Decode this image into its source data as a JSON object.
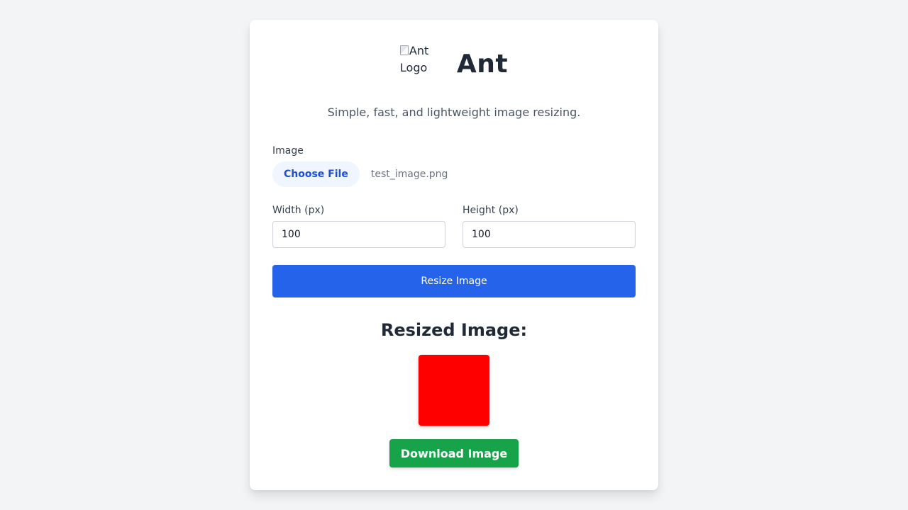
{
  "header": {
    "logo_alt": "Ant Logo",
    "title": "Ant"
  },
  "tagline": "Simple, fast, and lightweight image resizing.",
  "form": {
    "image_label": "Image",
    "choose_file_label": "Choose File",
    "selected_file": "test_image.png",
    "width_label": "Width (px)",
    "width_value": "100",
    "height_label": "Height (px)",
    "height_value": "100",
    "resize_label": "Resize Image"
  },
  "result": {
    "title": "Resized Image:",
    "image_color": "#ff0000",
    "download_label": "Download Image"
  },
  "colors": {
    "primary": "#2563eb",
    "success": "#16a34a",
    "background": "#f3f4f6"
  }
}
